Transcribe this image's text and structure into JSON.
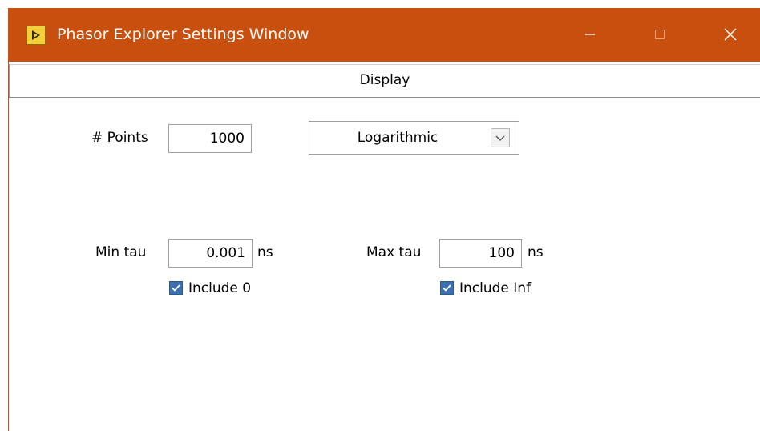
{
  "window": {
    "title": "Phasor Explorer Settings Window",
    "title_bar_color": "#c94f0f",
    "app_icon": "labview-vi-icon"
  },
  "title_buttons": {
    "minimize_icon": "minimize-icon",
    "maximize_icon": "maximize-icon",
    "close_icon": "close-icon"
  },
  "tabs": [
    {
      "label": "Display",
      "selected": true
    }
  ],
  "points": {
    "label": "# Points",
    "value": "1000"
  },
  "scale": {
    "selected": "Logarithmic",
    "arrow_icon": "chevron-down-icon"
  },
  "min_tau": {
    "label": "Min tau",
    "value": "0.001",
    "unit": "ns",
    "include_label": "Include 0",
    "include_checked": true
  },
  "max_tau": {
    "label": "Max tau",
    "value": "100",
    "unit": "ns",
    "include_label": "Include Inf",
    "include_checked": true
  },
  "colors": {
    "checkbox": "#3a6fb0"
  }
}
